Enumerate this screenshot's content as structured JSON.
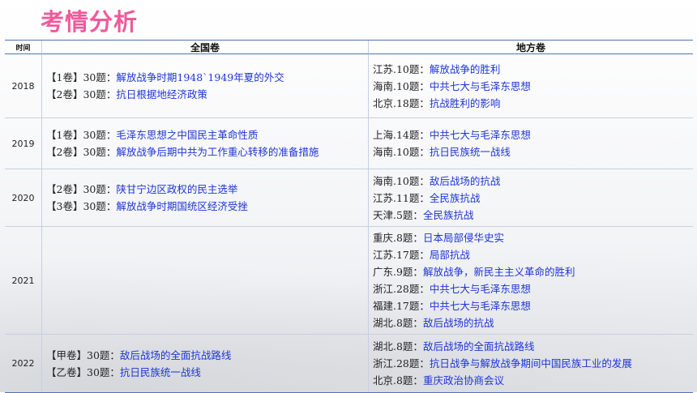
{
  "title": "考情分析",
  "headers": {
    "year": "时间",
    "national": "全国卷",
    "local": "地方卷"
  },
  "rows": [
    {
      "year": "2018",
      "national": [
        {
          "tag": "【1卷】30题：",
          "topic": "解放战争时期1948`1949年夏的外交"
        },
        {
          "tag": "【2卷】30题：",
          "topic": "抗日根据地经济政策"
        }
      ],
      "local": [
        {
          "tag": "江苏.10题：",
          "topic": "解放战争的胜利"
        },
        {
          "tag": "海南.10题：",
          "topic": "中共七大与毛泽东思想"
        },
        {
          "tag": "北京.18题：",
          "topic": "抗战胜利的影响"
        }
      ]
    },
    {
      "year": "2019",
      "national": [
        {
          "tag": "【1卷】30题：",
          "topic": "毛泽东思想之中国民主革命性质"
        },
        {
          "tag": "【2卷】30题：",
          "topic": "解放战争后期中共为工作重心转移的准备措施"
        }
      ],
      "local": [
        {
          "tag": "上海.14题：",
          "topic": "中共七大与毛泽东思想"
        },
        {
          "tag": "海南.10题：",
          "topic": "抗日民族统一战线"
        }
      ]
    },
    {
      "year": "2020",
      "national": [
        {
          "tag": "【2卷】30题：",
          "topic": "陕甘宁边区政权的民主选举"
        },
        {
          "tag": "【3卷】30题：",
          "topic": "解放战争时期国统区经济受挫"
        }
      ],
      "local": [
        {
          "tag": "海南.10题：",
          "topic": "敌后战场的抗战"
        },
        {
          "tag": "江苏.11题：",
          "topic": "全民族抗战"
        },
        {
          "tag": "天津.5题：",
          "topic": "全民族抗战"
        }
      ]
    },
    {
      "year": "2021",
      "national": [],
      "local": [
        {
          "tag": "重庆.8题：",
          "topic": "日本局部侵华史实"
        },
        {
          "tag": "江苏.17题：",
          "topic": "局部抗战"
        },
        {
          "tag": "广东.9题：",
          "topic": "解放战争，新民主主义革命的胜利"
        },
        {
          "tag": "浙江.28题：",
          "topic": "中共七大与毛泽东思想"
        },
        {
          "tag": "福建.17题：",
          "topic": "中共七大与毛泽东思想"
        },
        {
          "tag": "湖北.8题：",
          "topic": "敌后战场的抗战"
        }
      ]
    },
    {
      "year": "2022",
      "national": [
        {
          "tag": "【甲卷】30题：",
          "topic": "敌后战场的全面抗战路线"
        },
        {
          "tag": "【乙卷】30题：",
          "topic": "抗日民族统一战线"
        }
      ],
      "local": [
        {
          "tag": "湖北.8题：",
          "topic": "敌后战场的全面抗战路线"
        },
        {
          "tag": "浙江.28题：",
          "topic": "抗日战争与解放战争期间中国民族工业的发展"
        },
        {
          "tag": "北京.8题：",
          "topic": "重庆政治协商会议"
        }
      ]
    }
  ]
}
